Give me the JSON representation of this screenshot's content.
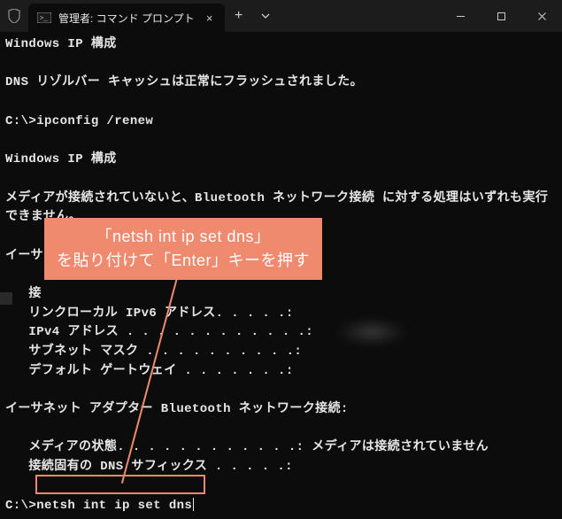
{
  "window": {
    "tab_title": "管理者: コマンド プロンプト",
    "new_tab_label": "+",
    "dropdown_label": "⌄",
    "close_label": "×",
    "minimize_label": "—",
    "maximize_label": "☐"
  },
  "terminal": {
    "lines": [
      "Windows IP 構成",
      "",
      "DNS リゾルバー キャッシュは正常にフラッシュされました。",
      "",
      "C:\\>ipconfig /renew",
      "",
      "Windows IP 構成",
      "",
      "メディアが接続されていないと、Bluetooth ネットワーク接続 に対する処理はいずれも実行できません。",
      "",
      "イーサ",
      "",
      "   接",
      "   リンクローカル IPv6 アドレス. . . . .:",
      "   IPv4 アドレス . . . . . . . . . . . .:",
      "   サブネット マスク . . . . . . . . . .:",
      "   デフォルト ゲートウェイ . . . . . . .:",
      "",
      "イーサネット アダプター Bluetooth ネットワーク接続:",
      "",
      "   メディアの状態. . . . . . . . . . . .: メディアは接続されていません",
      "   接続固有の DNS サフィックス . . . . .:",
      "",
      "C:\\>netsh int ip set dns"
    ]
  },
  "callout": {
    "line1": "「netsh int ip set dns」",
    "line2": "を貼り付けて「Enter」キーを押す"
  }
}
